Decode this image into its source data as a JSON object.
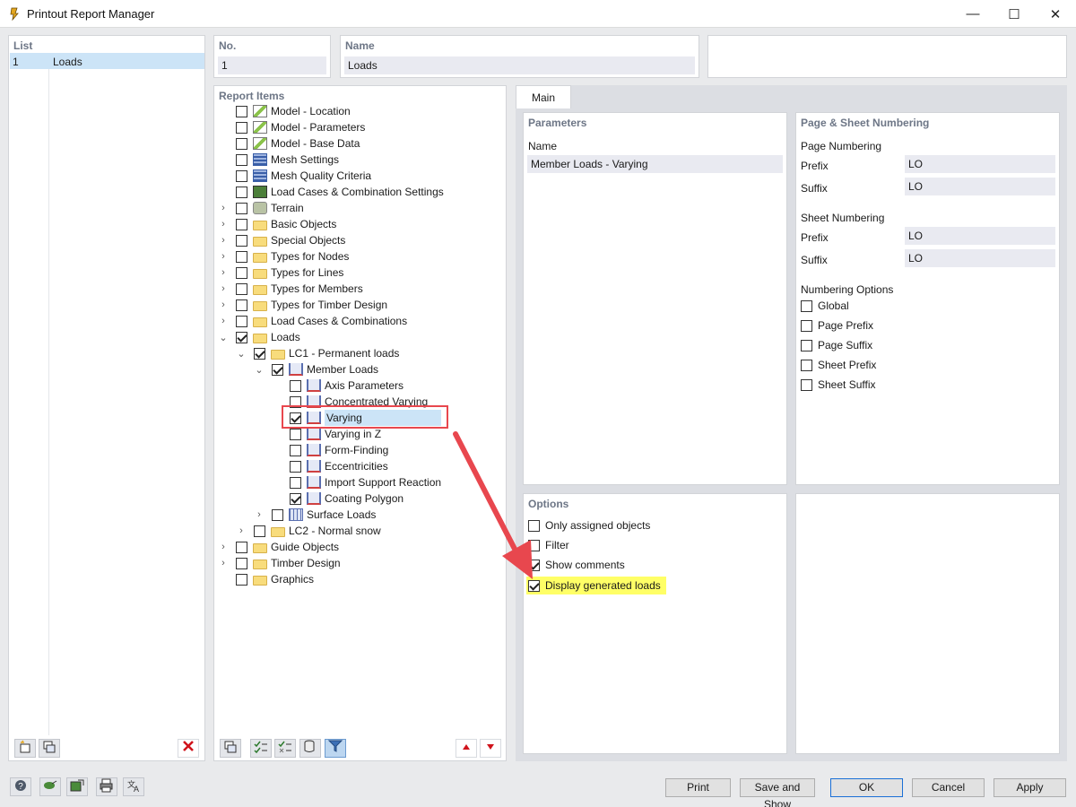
{
  "window": {
    "title": "Printout Report Manager",
    "minimize": "—",
    "maximize": "☐",
    "close": "✕"
  },
  "list": {
    "header": "List",
    "rows": [
      {
        "no": "1",
        "name": "Loads"
      }
    ]
  },
  "no_field": {
    "label": "No.",
    "value": "1"
  },
  "name_field": {
    "label": "Name",
    "value": "Loads"
  },
  "report_items": {
    "header": "Report Items",
    "items": [
      {
        "label": "Model - Location",
        "checked": false,
        "expand": "",
        "icon": "model-icon",
        "level": 0
      },
      {
        "label": "Model - Parameters",
        "checked": false,
        "expand": "",
        "icon": "model-icon",
        "level": 0
      },
      {
        "label": "Model - Base Data",
        "checked": false,
        "expand": "",
        "icon": "model-icon",
        "level": 0
      },
      {
        "label": "Mesh Settings",
        "checked": false,
        "expand": "",
        "icon": "mesh-icon",
        "level": 0
      },
      {
        "label": "Mesh Quality Criteria",
        "checked": false,
        "expand": "",
        "icon": "mesh-icon",
        "level": 0
      },
      {
        "label": "Load Cases & Combination Settings",
        "checked": false,
        "expand": "",
        "icon": "load-case-icon",
        "level": 0
      },
      {
        "label": "Terrain",
        "checked": false,
        "expand": ">",
        "icon": "terrain-icon",
        "level": 0
      },
      {
        "label": "Basic Objects",
        "checked": false,
        "expand": ">",
        "icon": "folder-icon",
        "level": 0
      },
      {
        "label": "Special Objects",
        "checked": false,
        "expand": ">",
        "icon": "folder-icon",
        "level": 0
      },
      {
        "label": "Types for Nodes",
        "checked": false,
        "expand": ">",
        "icon": "folder-icon",
        "level": 0
      },
      {
        "label": "Types for Lines",
        "checked": false,
        "expand": ">",
        "icon": "folder-icon",
        "level": 0
      },
      {
        "label": "Types for Members",
        "checked": false,
        "expand": ">",
        "icon": "folder-icon",
        "level": 0
      },
      {
        "label": "Types for Timber Design",
        "checked": false,
        "expand": ">",
        "icon": "folder-icon",
        "level": 0
      },
      {
        "label": "Load Cases & Combinations",
        "checked": false,
        "expand": ">",
        "icon": "folder-icon",
        "level": 0
      },
      {
        "label": "Loads",
        "checked": true,
        "expand": "v",
        "icon": "folder-icon",
        "level": 0
      },
      {
        "label": "LC1 - Permanent loads",
        "checked": true,
        "expand": "v",
        "icon": "folder-icon",
        "level": 1
      },
      {
        "label": "Member Loads",
        "checked": true,
        "expand": "v",
        "icon": "member-load-icon",
        "level": 2
      },
      {
        "label": "Axis Parameters",
        "checked": false,
        "expand": "",
        "icon": "member-load-icon",
        "level": 3
      },
      {
        "label": "Concentrated Varying",
        "checked": false,
        "expand": "",
        "icon": "member-load-icon",
        "level": 3
      },
      {
        "label": "Varying",
        "checked": true,
        "expand": "",
        "icon": "member-load-icon",
        "level": 3,
        "selected": true
      },
      {
        "label": "Varying in Z",
        "checked": false,
        "expand": "",
        "icon": "member-load-icon",
        "level": 3
      },
      {
        "label": "Form-Finding",
        "checked": false,
        "expand": "",
        "icon": "member-load-icon",
        "level": 3
      },
      {
        "label": "Eccentricities",
        "checked": false,
        "expand": "",
        "icon": "member-load-icon",
        "level": 3
      },
      {
        "label": "Import Support Reaction",
        "checked": false,
        "expand": "",
        "icon": "member-load-icon",
        "level": 3
      },
      {
        "label": "Coating Polygon",
        "checked": true,
        "expand": "",
        "icon": "member-load-icon",
        "level": 3
      },
      {
        "label": "Surface Loads",
        "checked": false,
        "expand": ">",
        "icon": "surface-load-icon",
        "level": 2
      },
      {
        "label": "LC2 - Normal snow",
        "checked": false,
        "expand": ">",
        "icon": "folder-icon",
        "level": 1
      },
      {
        "label": "Guide Objects",
        "checked": false,
        "expand": ">",
        "icon": "folder-icon",
        "level": 0
      },
      {
        "label": "Timber Design",
        "checked": false,
        "expand": ">",
        "icon": "folder-icon",
        "level": 0
      },
      {
        "label": "Graphics",
        "checked": false,
        "expand": "",
        "icon": "folder-icon",
        "level": 0
      }
    ]
  },
  "tabs": {
    "main": "Main"
  },
  "parameters": {
    "header": "Parameters",
    "name_label": "Name",
    "name_value": "Member Loads - Varying"
  },
  "numbering": {
    "header": "Page & Sheet Numbering",
    "page_numbering": "Page Numbering",
    "page_prefix_label": "Prefix",
    "page_prefix_value": "LO",
    "page_suffix_label": "Suffix",
    "page_suffix_value": "LO",
    "sheet_numbering": "Sheet Numbering",
    "sheet_prefix_label": "Prefix",
    "sheet_prefix_value": "LO",
    "sheet_suffix_label": "Suffix",
    "sheet_suffix_value": "LO",
    "options_header": "Numbering Options",
    "options": [
      {
        "label": "Global",
        "checked": false
      },
      {
        "label": "Page Prefix",
        "checked": false
      },
      {
        "label": "Page Suffix",
        "checked": false
      },
      {
        "label": "Sheet Prefix",
        "checked": false
      },
      {
        "label": "Sheet Suffix",
        "checked": false
      }
    ]
  },
  "options": {
    "header": "Options",
    "items": [
      {
        "label": "Only assigned objects",
        "checked": false
      },
      {
        "label": "Filter",
        "checked": false
      },
      {
        "label": "Show comments",
        "checked": true
      },
      {
        "label": "Display generated loads",
        "checked": true,
        "highlight": true
      }
    ]
  },
  "footer": {
    "print": "Print",
    "save_show": "Save and Show",
    "ok": "OK",
    "cancel": "Cancel",
    "apply": "Apply"
  },
  "colors": {
    "accent": "#1a6fd6",
    "highlight": "#ffff66",
    "annotation_red": "#e8474e",
    "selection": "#cce4f7"
  }
}
